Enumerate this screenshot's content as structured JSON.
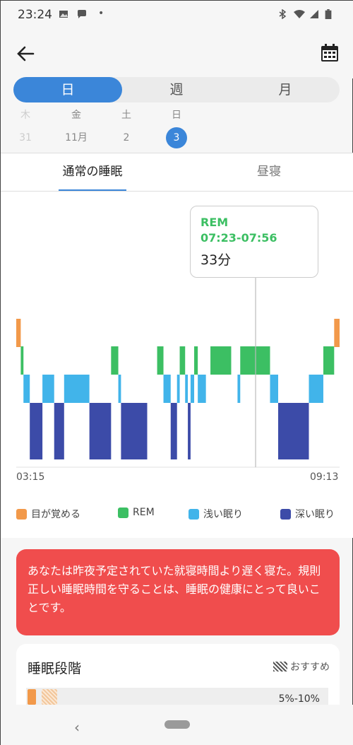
{
  "status_bar": {
    "time": "23:24",
    "dot": "•"
  },
  "colors": {
    "accent": "#3b86d9",
    "awake": "#f2994a",
    "rem": "#3cbf63",
    "light": "#41b4ea",
    "deep": "#3c4ba8",
    "alert": "#f04d4d"
  },
  "range_tabs": [
    {
      "label": "日",
      "active": true
    },
    {
      "label": "週",
      "active": false
    },
    {
      "label": "月",
      "active": false
    }
  ],
  "date_strip": [
    {
      "dow": "木",
      "num": "31",
      "state": "faded"
    },
    {
      "dow": "金",
      "num": "11月",
      "state": "normal"
    },
    {
      "dow": "土",
      "num": "2",
      "state": "normal"
    },
    {
      "dow": "日",
      "num": "3",
      "state": "selected"
    }
  ],
  "sleep_tabs": [
    {
      "label": "通常の睡眠",
      "active": true
    },
    {
      "label": "昼寝",
      "active": false
    }
  ],
  "tooltip": {
    "stage": "REM",
    "time_range": "07:23-07:56",
    "duration": "33分"
  },
  "chart_data": {
    "type": "hypnogram",
    "x_start": "03:15",
    "x_end": "09:13",
    "stages": [
      "目が覚める",
      "REM",
      "浅い眠り",
      "深い眠り"
    ],
    "segments": [
      {
        "stage": "目が覚める",
        "start": "03:15",
        "end": "03:20"
      },
      {
        "stage": "REM",
        "start": "03:20",
        "end": "03:23"
      },
      {
        "stage": "浅い眠り",
        "start": "03:23",
        "end": "03:30"
      },
      {
        "stage": "深い眠り",
        "start": "03:30",
        "end": "03:44"
      },
      {
        "stage": "浅い眠り",
        "start": "03:44",
        "end": "03:57"
      },
      {
        "stage": "深い眠り",
        "start": "03:57",
        "end": "04:08"
      },
      {
        "stage": "浅い眠り",
        "start": "04:08",
        "end": "04:36"
      },
      {
        "stage": "深い眠り",
        "start": "04:36",
        "end": "05:00"
      },
      {
        "stage": "REM",
        "start": "05:00",
        "end": "05:08"
      },
      {
        "stage": "浅い眠り",
        "start": "05:08",
        "end": "05:11"
      },
      {
        "stage": "深い眠り",
        "start": "05:11",
        "end": "05:40"
      },
      {
        "stage": "REM",
        "start": "05:51",
        "end": "05:58"
      },
      {
        "stage": "浅い眠り",
        "start": "05:58",
        "end": "06:06"
      },
      {
        "stage": "深い眠り",
        "start": "06:06",
        "end": "06:13"
      },
      {
        "stage": "浅い眠り",
        "start": "06:13",
        "end": "06:16"
      },
      {
        "stage": "REM",
        "start": "06:16",
        "end": "06:22"
      },
      {
        "stage": "浅い眠り",
        "start": "06:22",
        "end": "06:25"
      },
      {
        "stage": "深い眠り",
        "start": "06:25",
        "end": "06:28"
      },
      {
        "stage": "浅い眠り",
        "start": "06:28",
        "end": "06:32"
      },
      {
        "stage": "REM",
        "start": "06:32",
        "end": "06:36"
      },
      {
        "stage": "浅い眠り",
        "start": "06:36",
        "end": "06:45"
      },
      {
        "stage": "REM",
        "start": "06:50",
        "end": "07:13"
      },
      {
        "stage": "浅い眠り",
        "start": "07:20",
        "end": "07:23"
      },
      {
        "stage": "REM",
        "start": "07:23",
        "end": "07:56"
      },
      {
        "stage": "浅い眠り",
        "start": "07:56",
        "end": "08:05"
      },
      {
        "stage": "深い眠り",
        "start": "08:05",
        "end": "08:39"
      },
      {
        "stage": "浅い眠り",
        "start": "08:39",
        "end": "08:55"
      },
      {
        "stage": "REM",
        "start": "08:55",
        "end": "09:07"
      },
      {
        "stage": "目が覚める",
        "start": "09:07",
        "end": "09:13"
      }
    ],
    "cursor_time": "07:40"
  },
  "legend": [
    {
      "label": "目が覚める",
      "color": "#f2994a"
    },
    {
      "label": "REM",
      "color": "#3cbf63"
    },
    {
      "label": "浅い眠り",
      "color": "#41b4ea"
    },
    {
      "label": "深い眠り",
      "color": "#3c4ba8"
    }
  ],
  "alert": {
    "text": "あなたは昨夜予定されていた就寝時間より遅く寝た。規則正しい睡眠時間を守ることは、睡眠の健康にとって良いことです。"
  },
  "stage_card": {
    "title": "睡眠段階",
    "recommended_label": "おすすめ",
    "awake_range": "5%-10%"
  },
  "nav": {
    "back_glyph": "‹"
  }
}
